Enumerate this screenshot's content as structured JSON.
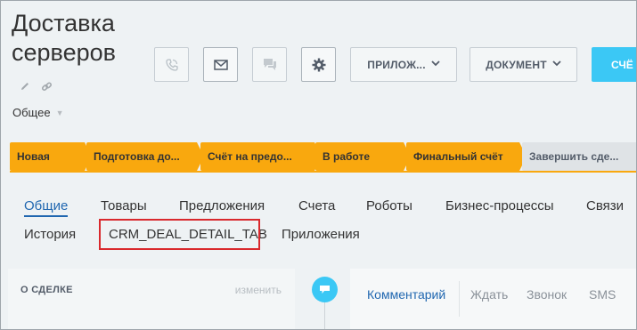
{
  "deal": {
    "title": "Доставка серверов",
    "category": "Общее"
  },
  "toolbar": {
    "apps_label": "ПРИЛОЖ...",
    "document_label": "ДОКУМЕНТ",
    "invoice_label": "СЧЁ"
  },
  "stages": [
    {
      "label": "Новая"
    },
    {
      "label": "Подготовка до..."
    },
    {
      "label": "Счёт на предо..."
    },
    {
      "label": "В работе"
    },
    {
      "label": "Финальный счёт"
    },
    {
      "label": "Завершить сде..."
    }
  ],
  "tabs_row1": [
    {
      "label": "Общие"
    },
    {
      "label": "Товары"
    },
    {
      "label": "Предложения"
    },
    {
      "label": "Счета"
    },
    {
      "label": "Роботы"
    },
    {
      "label": "Бизнес-процессы"
    },
    {
      "label": "Связи"
    }
  ],
  "tabs_row2": [
    {
      "label": "История"
    },
    {
      "label": "CRM_DEAL_DETAIL_TAB"
    },
    {
      "label": "Приложения"
    }
  ],
  "about": {
    "heading": "О СДЕЛКЕ",
    "edit_label": "изменить"
  },
  "activity_tabs": [
    {
      "label": "Комментарий"
    },
    {
      "label": "Ждать"
    },
    {
      "label": "Звонок"
    },
    {
      "label": "SMS"
    }
  ],
  "colors": {
    "stage_active": "#f9a80e",
    "accent_blue": "#2067b0",
    "primary_button": "#3bc8f5",
    "highlight": "#d9292d"
  }
}
